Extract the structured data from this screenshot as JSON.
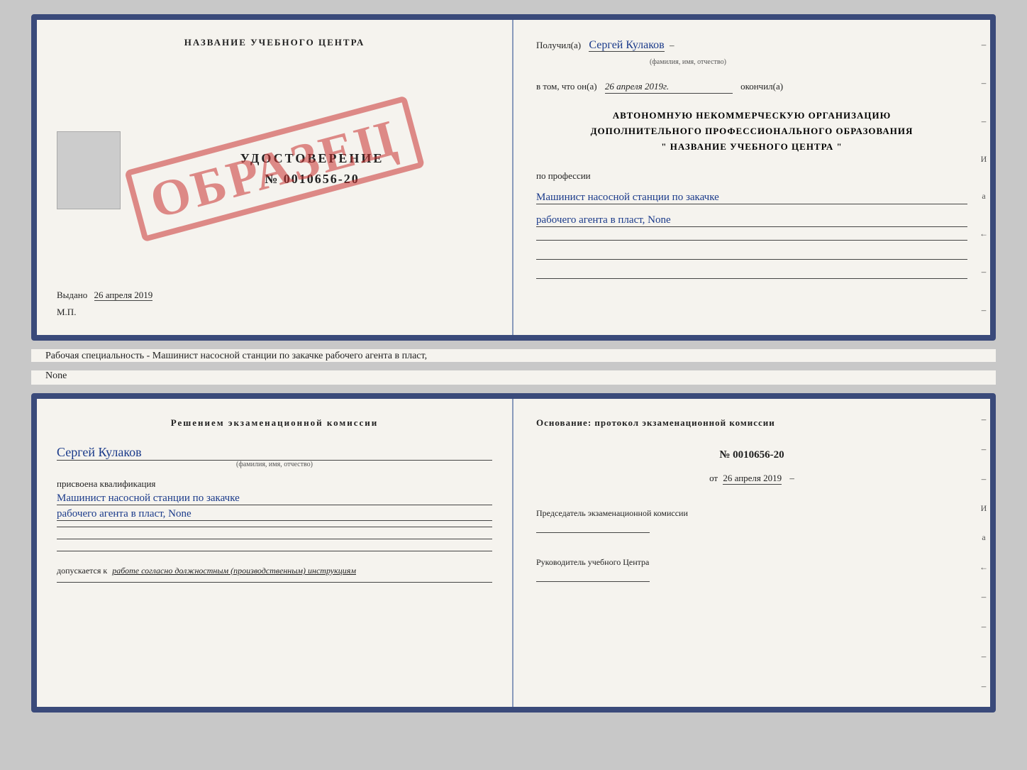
{
  "top_left": {
    "title": "НАЗВАНИЕ УЧЕБНОГО ЦЕНТРА",
    "cert_type": "УДОСТОВЕРЕНИЕ",
    "cert_number": "№ 0010656-20",
    "stamp": "ОБРАЗЕЦ",
    "issued_label": "Выдано",
    "issued_date": "26 апреля 2019",
    "mp_label": "М.П."
  },
  "top_right": {
    "received_label": "Получил(а)",
    "person_name": "Сергей Кулаков",
    "name_sublabel": "(фамилия, имя, отчество)",
    "date_prefix": "в том, что он(а)",
    "date_value": "26 апреля 2019г.",
    "finished_label": "окончил(а)",
    "org_line1": "АВТОНОМНУЮ НЕКОММЕРЧЕСКУЮ ОРГАНИЗАЦИЮ",
    "org_line2": "ДОПОЛНИТЕЛЬНОГО ПРОФЕССИОНАЛЬНОГО ОБРАЗОВАНИЯ",
    "org_line3": "\"  НАЗВАНИЕ УЧЕБНОГО ЦЕНТРА  \"",
    "profession_label": "по профессии",
    "profession_line1": "Машинист насосной станции по закачке",
    "profession_line2": "рабочего агента в пласт, None"
  },
  "specialty_text": "Рабочая специальность - Машинист насосной станции по закачке рабочего агента в пласт,",
  "specialty_text2": "None",
  "bottom_left": {
    "title_line1": "Решением  экзаменационной  комиссии",
    "person_name": "Сергей Кулаков",
    "name_sublabel": "(фамилия, имя, отчество)",
    "qualification_label": "присвоена квалификация",
    "qualification_line1": "Машинист насосной станции по закачке",
    "qualification_line2": "рабочего агента в пласт, None",
    "admission_text": "допускается к",
    "admission_hand": "работе согласно должностным (производственным) инструкциям"
  },
  "bottom_right": {
    "basis_label": "Основание: протокол экзаменационной  комиссии",
    "protocol_number": "№  0010656-20",
    "date_prefix": "от",
    "date_value": "26 апреля 2019",
    "chairman_title": "Председатель экзаменационной комиссии",
    "director_title": "Руководитель учебного Центра"
  },
  "side_marks": {
    "dash1": "–",
    "dash2": "–",
    "dash3": "–",
    "letter_i": "И",
    "letter_a": "а",
    "arrow": "←",
    "dash4": "–",
    "dash5": "–",
    "dash6": "–",
    "dash7": "–",
    "dash8": "–",
    "dash9": "–"
  }
}
